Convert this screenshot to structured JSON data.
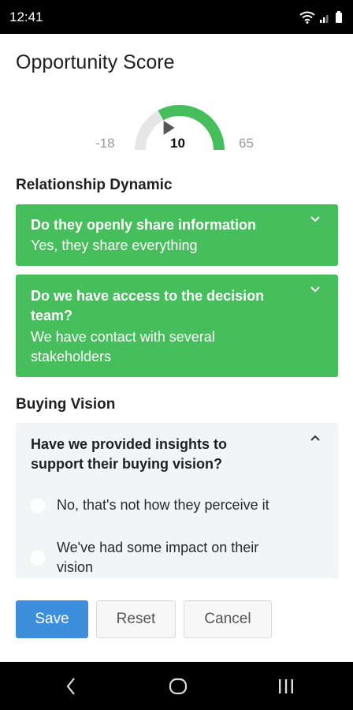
{
  "status_bar": {
    "time": "12:41"
  },
  "title": "Opportunity Score",
  "gauge": {
    "min": "-18",
    "value": "10",
    "max": "65",
    "level_fraction": 0.34,
    "color": "#45be5b"
  },
  "sections": [
    {
      "title": "Relationship Dynamic",
      "questions": [
        {
          "question": "Do they openly share information",
          "answer": "Yes, they share everything"
        },
        {
          "question_lines": [
            "Do we have access to the decision",
            "team?"
          ],
          "answer_lines": [
            "We have contact with several",
            "stakeholders"
          ]
        }
      ]
    },
    {
      "title": "Buying Vision",
      "questions": [
        {
          "question_lines": [
            "Have we provided insights to",
            "support their buying vision?"
          ],
          "options": [
            {
              "label": "No, that's not how they perceive it"
            },
            {
              "label_lines": [
                "We've had some impact on their",
                "vision"
              ]
            }
          ]
        }
      ]
    }
  ],
  "buttons": {
    "save": "Save",
    "reset": "Reset",
    "cancel": "Cancel"
  },
  "colors": {
    "answered": "#45be5b",
    "primary": "#3d8edb"
  }
}
